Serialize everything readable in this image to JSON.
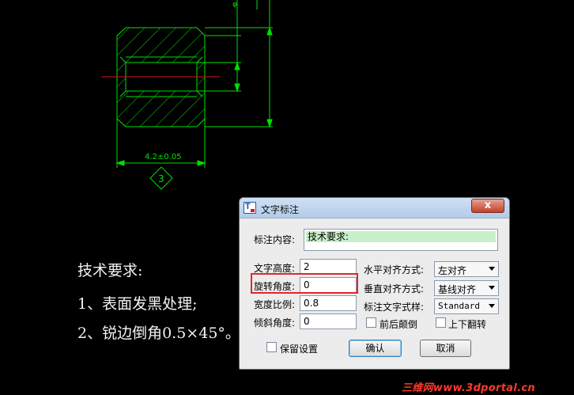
{
  "drawing": {
    "dimension_text": "4.2±0.05",
    "balloon_number": "3",
    "top_dim_text": "φ"
  },
  "tech_notes": {
    "heading": "技术要求:",
    "item1": "1、表面发黑处理;",
    "item2": "2、锐边倒角0.5×45°。"
  },
  "dialog": {
    "title": "文字标注",
    "close_label": "x",
    "content_label": "标注内容:",
    "content_value": "技术要求:",
    "text_height_label": "文字高度:",
    "text_height_value": "2",
    "rotation_label": "旋转角度:",
    "rotation_value": "0",
    "width_ratio_label": "宽度比例:",
    "width_ratio_value": "0.8",
    "slant_label": "倾斜角度:",
    "slant_value": "0",
    "h_align_label": "水平对齐方式:",
    "h_align_value": "左对齐",
    "v_align_label": "垂直对齐方式:",
    "v_align_value": "基线对齐",
    "style_label": "标注文字式样:",
    "style_value": "Standard",
    "reverse_label": "前后颠倒",
    "flip_label": "上下翻转",
    "keep_label": "保留设置",
    "ok_label": "确认",
    "cancel_label": "取消"
  },
  "watermark": "三维网www.3dportal.cn",
  "colors": {
    "drawing": "#00e000",
    "centerline": "#e01010",
    "background": "#000000",
    "highlight_box": "#e0282c"
  }
}
